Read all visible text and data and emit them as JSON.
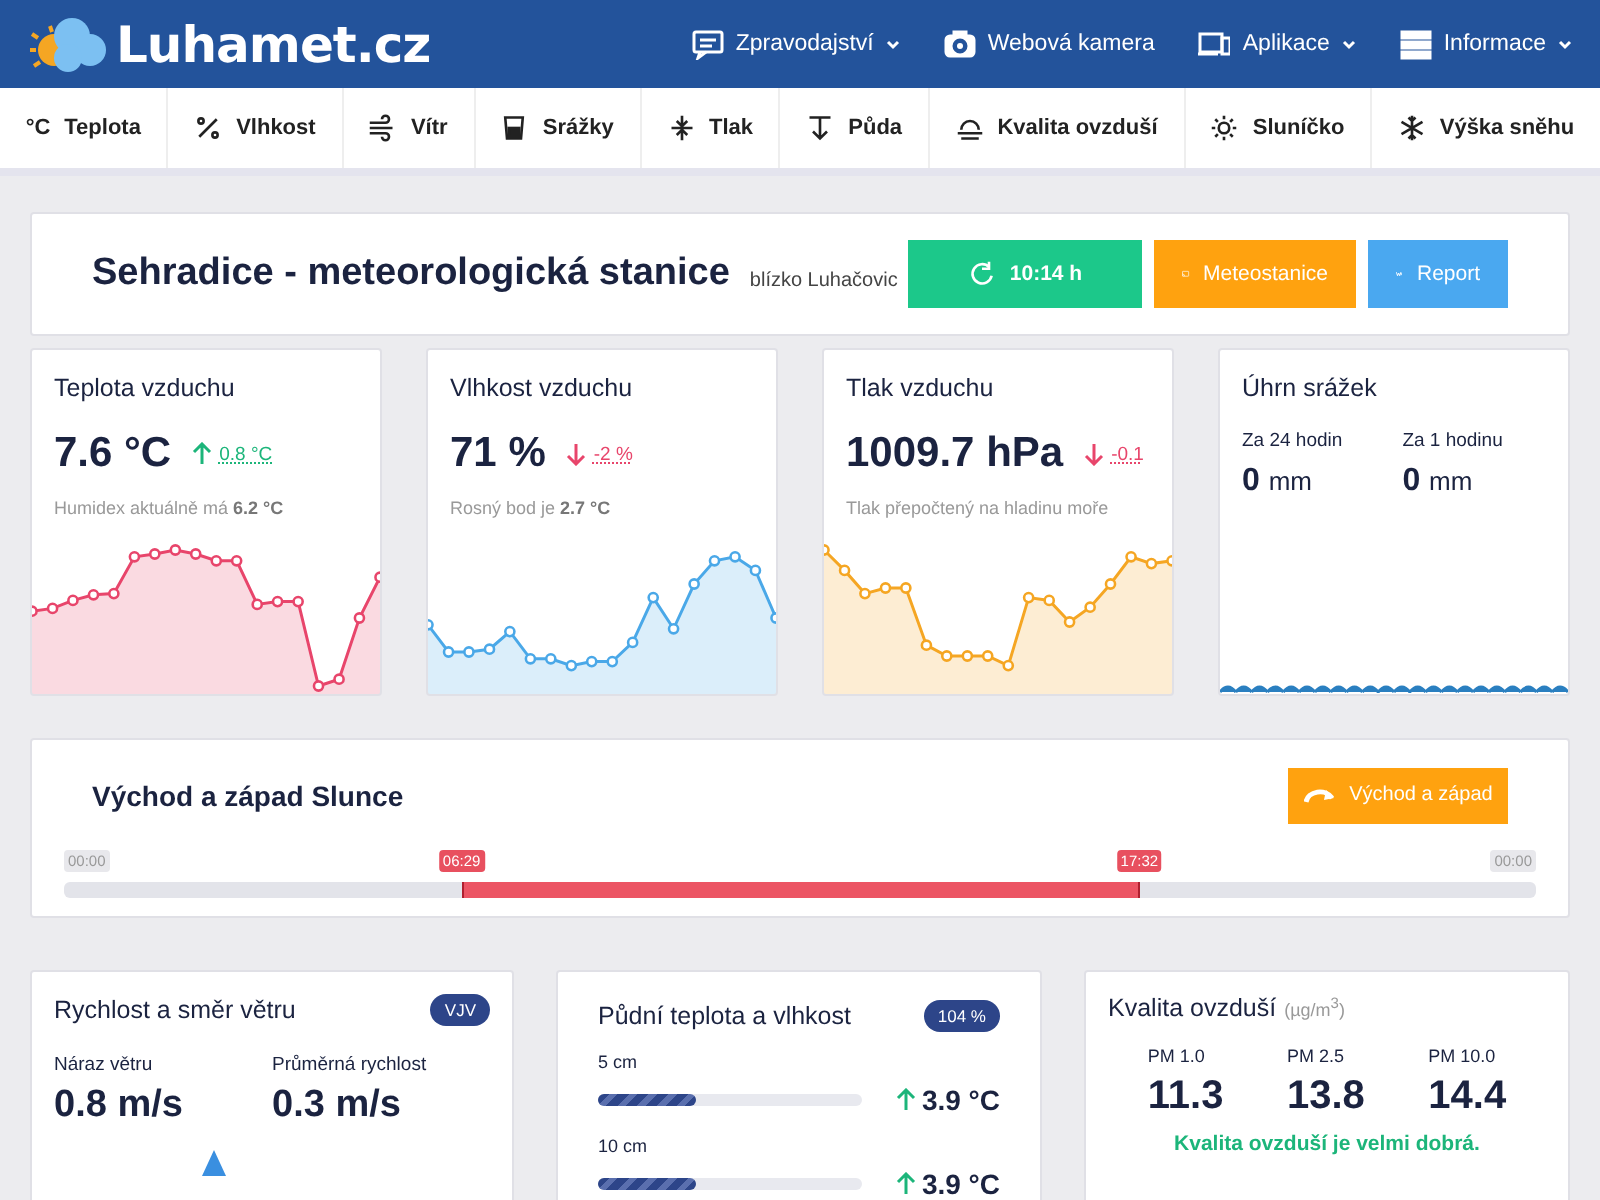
{
  "header": {
    "logo": "Luhamet.cz",
    "menu": [
      {
        "label": "Zpravodajství",
        "kind": "chat",
        "dropdown": true
      },
      {
        "label": "Webová kamera",
        "kind": "camera",
        "dropdown": false
      },
      {
        "label": "Aplikace",
        "kind": "devices",
        "dropdown": true
      },
      {
        "label": "Informace",
        "kind": "list",
        "dropdown": true
      }
    ]
  },
  "nav": [
    {
      "label": "Teplota",
      "kind": "symbol",
      "symbol": "°C"
    },
    {
      "label": "Vlhkost",
      "kind": "humidity"
    },
    {
      "label": "Vítr",
      "kind": "wind"
    },
    {
      "label": "Srážky",
      "kind": "rain"
    },
    {
      "label": "Tlak",
      "kind": "pressure"
    },
    {
      "label": "Půda",
      "kind": "soil"
    },
    {
      "label": "Kvalita ovzduší",
      "kind": "air"
    },
    {
      "label": "Sluníčko",
      "kind": "sun"
    },
    {
      "label": "Výška sněhu",
      "kind": "snow"
    }
  ],
  "station": {
    "title": "Sehradice - meteorologická stanice",
    "subtitle": "blízko Luhačovic",
    "buttons": [
      {
        "label": "10:14 h",
        "kind": "refresh",
        "color": "#1cc88a"
      },
      {
        "label": "Meteostanice",
        "kind": "cast",
        "color": "#ffa20f"
      },
      {
        "label": "Report",
        "kind": "wu",
        "color": "#4aa8f0"
      }
    ]
  },
  "cards": [
    {
      "kind": "measure",
      "title": "Teplota vzduchu",
      "value": "7.6 °C",
      "rising": true,
      "change": "0.8 °C",
      "note": "Humidex aktuálně má **6.2 °C**",
      "color": "#e8456b"
    },
    {
      "kind": "measure",
      "title": "Vlhkost vzduchu",
      "value": "71 %",
      "rising": false,
      "change": "-2 %",
      "note": "Rosný bod je **2.7 °C**",
      "color": "#4aa8e8"
    },
    {
      "kind": "measure",
      "title": "Tlak vzduchu",
      "value": "1009.7 hPa",
      "rising": false,
      "change": "-0.1",
      "note": "Tlak přepočtený na hladinu moře",
      "color": "#f5a623"
    },
    {
      "kind": "rain",
      "title": "Úhrn srážek",
      "items": [
        {
          "label": "Za 24 hodin",
          "value": "0",
          "unit": "mm"
        },
        {
          "label": "Za 1 hodinu",
          "value": "0",
          "unit": "mm"
        }
      ],
      "color": "#2a7fc0"
    }
  ],
  "sun": {
    "title": "Východ a západ Slunce",
    "button": "Východ a západ",
    "scale_start": "00:00",
    "sunrise": "06:29",
    "sunset": "17:32",
    "scale_end": "00:00"
  },
  "wind": {
    "title": "Rychlost a směr větru",
    "direction": "VJV",
    "items": [
      {
        "label": "Náraz větru",
        "value": "0.8 m/s"
      },
      {
        "label": "Průměrná rychlost",
        "value": "0.3 m/s"
      }
    ]
  },
  "soil": {
    "title": "Půdní teplota a vlhkost",
    "badge": "104 %",
    "rows": [
      {
        "depth": "5 cm",
        "level": 0.37,
        "rising": true,
        "value": "3.9 °C"
      },
      {
        "depth": "10 cm",
        "level": 0.37,
        "rising": true,
        "value": "3.9 °C"
      }
    ]
  },
  "air": {
    "title": "Kvalita ovzduší",
    "unit": "(µg/m$^{3}$)",
    "items": [
      {
        "label": "PM 1.0",
        "value": "11.3"
      },
      {
        "label": "PM 2.5",
        "value": "13.8"
      },
      {
        "label": "PM 10.0",
        "value": "14.4"
      }
    ],
    "verdict": "Kvalita ovzduší je velmi dobrá."
  }
}
